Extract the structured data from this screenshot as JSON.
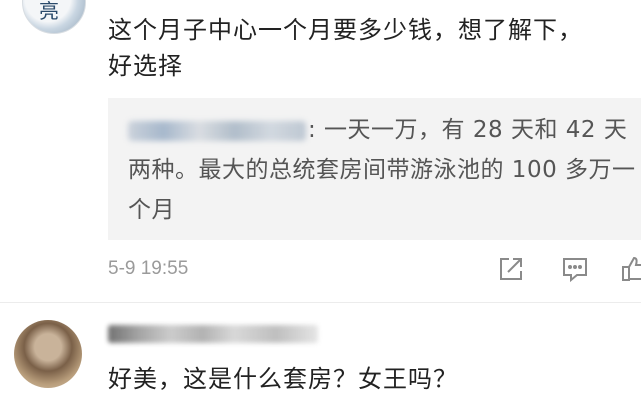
{
  "comment1": {
    "text_line1": "这个月子中心一个月要多少钱，想了解下，",
    "text_line2": "好选择",
    "reply": {
      "text": ": 一天一万，有 28 天和 42 天两种。最大的总统套房间带游泳池的 100 多万一个月"
    },
    "timestamp": "5-9 19:55",
    "actions": {
      "share_icon": "share-icon",
      "comment_icon": "comment-icon",
      "like_icon": "like-icon"
    }
  },
  "comment2": {
    "text": "好美，这是什么套房？女王吗？"
  },
  "colors": {
    "text": "#222222",
    "reply_text": "#555555",
    "reply_bg": "#f3f3f3",
    "timestamp": "#9a9a9a",
    "icon": "#8a8a8a"
  }
}
